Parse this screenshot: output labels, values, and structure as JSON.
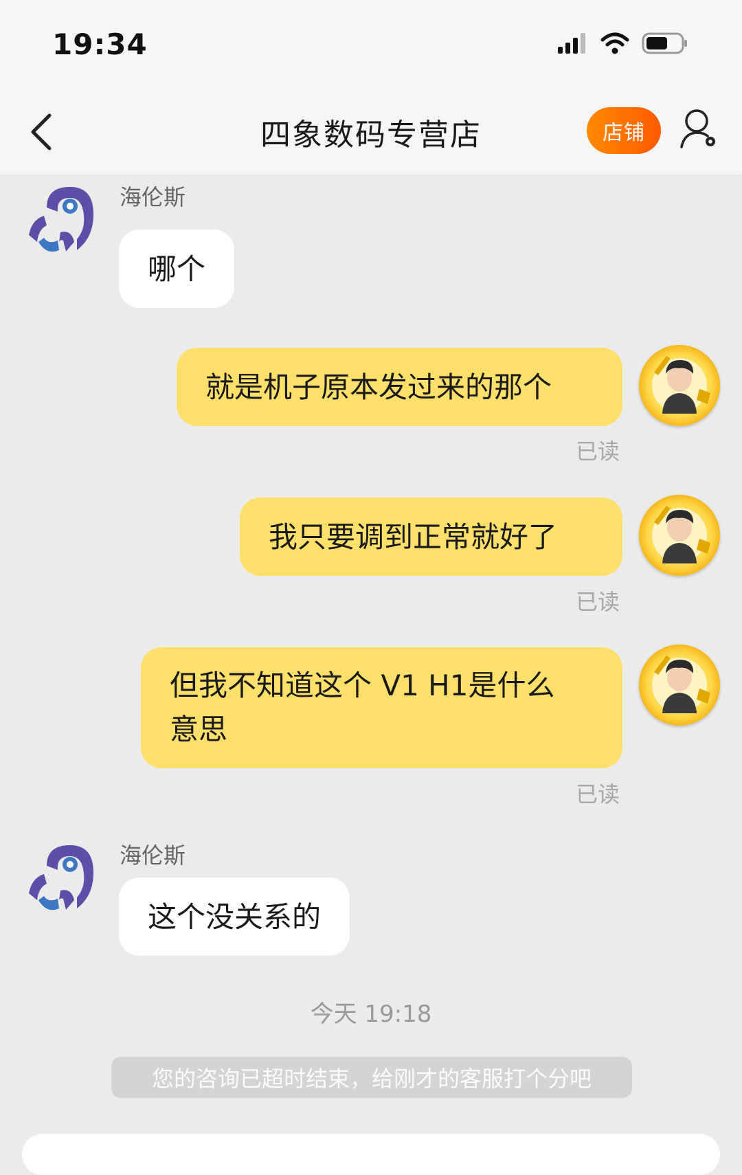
{
  "status_bar": {
    "time": "19:34"
  },
  "header": {
    "title": "四象数码专营店",
    "shop_button": "店铺"
  },
  "messages": [
    {
      "sender": "海伦斯",
      "text": "哪个"
    },
    {
      "text": "就是机子原本发过来的那个",
      "status": "已读"
    },
    {
      "text": "我只要调到正常就好了",
      "status": "已读"
    },
    {
      "text": "但我不知道这个 V1 H1是什么意思",
      "status": "已读"
    },
    {
      "sender": "海伦斯",
      "text": "这个没关系的"
    }
  ],
  "timestamp": "今天 19:18",
  "system_notice": "您的咨询已超时结束，给刚才的客服打个分吧",
  "colors": {
    "accent": "#ff6a00",
    "outgoing_bubble": "#ffe06a",
    "incoming_bubble": "#ffffff",
    "background": "#ebebeb"
  }
}
